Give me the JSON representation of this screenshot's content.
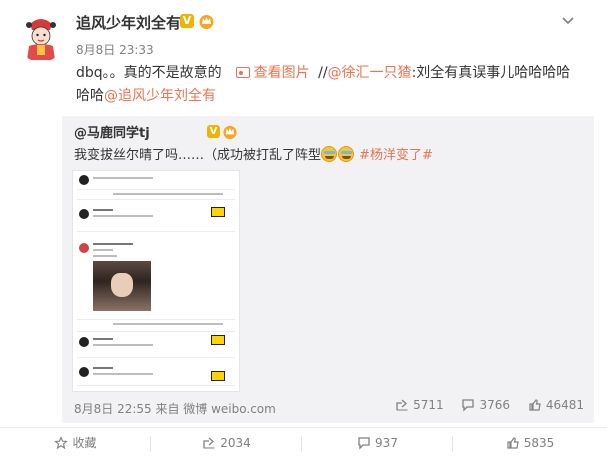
{
  "post": {
    "username": "追风少年刘全有",
    "time": "8月8日 23:33",
    "text_prefix": "dbq。。真的不是故意的",
    "view_pic": "查看图片",
    "slashes": "//",
    "mention": "@徐汇一只猹",
    "text_after_mention": ":刘全有真误事儿哈哈哈哈",
    "text_line2_prefix": "哈哈",
    "mention2": "@追风少年刘全有"
  },
  "repost": {
    "username": "@马鹿同学tj",
    "text": "我变拔丝尔晴了吗……（成功被打乱了阵型",
    "hashtag": "#杨洋变了#",
    "meta": "8月8日 22:55 来自 微博 weibo.com",
    "stats": {
      "shares": "5711",
      "comments": "3766",
      "likes": "46481"
    }
  },
  "footer": {
    "favorite": "收藏",
    "share": "2034",
    "comment": "937",
    "like": "5835"
  },
  "colors": {
    "accent": "#eb7350",
    "muted": "#808080",
    "repost_bg": "#f2f2f5",
    "badge": "#f0b300"
  }
}
